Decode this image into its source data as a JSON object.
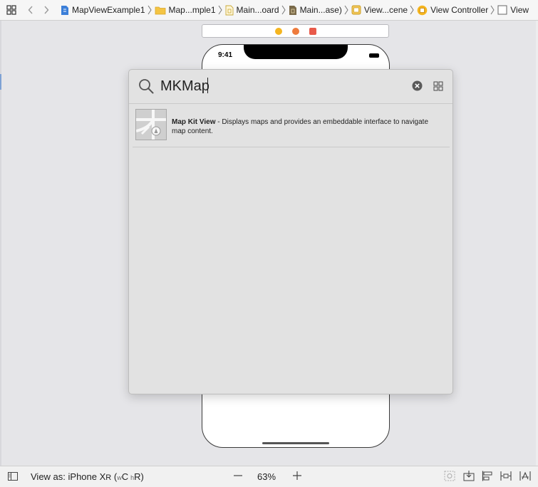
{
  "jumpbar": {
    "items": [
      {
        "label": "MapViewExample1",
        "icon": "project-file-icon"
      },
      {
        "label": "Map...mple1",
        "icon": "folder-icon"
      },
      {
        "label": "Main...oard",
        "icon": "storyboard-file-icon"
      },
      {
        "label": "Main...ase)",
        "icon": "storyboard-base-icon"
      },
      {
        "label": "View...cene",
        "icon": "scene-icon"
      },
      {
        "label": "View Controller",
        "icon": "view-controller-icon"
      },
      {
        "label": "View",
        "icon": "view-icon"
      }
    ]
  },
  "device": {
    "status_time": "9:41"
  },
  "library": {
    "search_query": "MKMap",
    "results": [
      {
        "title": "Map Kit View",
        "description": " - Displays maps and provides an embeddable interface to navigate map content.",
        "icon": "map-kit-view-icon"
      }
    ]
  },
  "bottombar": {
    "view_as_prefix": "View as: iPhone X",
    "view_as_model_suffix": "R",
    "view_as_paren_open": " (",
    "size_class_w_small": "w",
    "size_class_w": "C",
    "size_class_h_small": "h",
    "size_class_h": "R",
    "view_as_paren_close": ")",
    "zoom_level": "63%"
  },
  "colors": {
    "accent_blue": "#3c7fd8",
    "dock_yellow": "#f5b51f",
    "dock_orange": "#ee7b3c",
    "dock_red": "#e85a4a"
  }
}
